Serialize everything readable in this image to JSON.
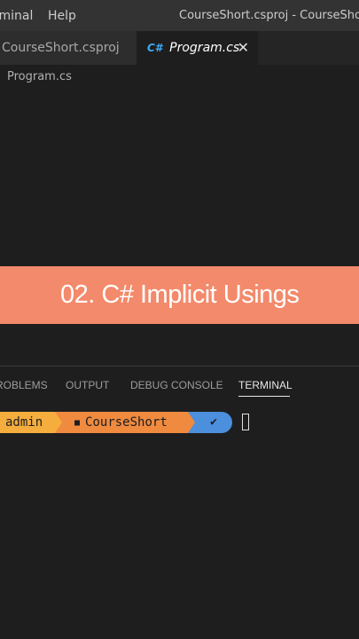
{
  "menu": {
    "terminal": "rminal",
    "help": "Help"
  },
  "window_title": "CourseShort.csproj - CourseShort -",
  "tabs": [
    {
      "label": "CourseShort.csproj",
      "active": false
    },
    {
      "label": "Program.cs",
      "icon": "C#",
      "active": true,
      "close": "✕"
    }
  ],
  "breadcrumb": "Program.cs",
  "banner": {
    "text": "02. C#  Implicit Usings",
    "color": "#f38a6b"
  },
  "panel_tabs": [
    "ROBLEMS",
    "OUTPUT",
    "DEBUG CONSOLE",
    "TERMINAL"
  ],
  "terminal": {
    "user": "admin",
    "path": "CourseShort",
    "folder_icon": "■",
    "status": "✔",
    "colors": {
      "user": "#f5ad3e",
      "path": "#ef8a3f",
      "status": "#4c8fdd"
    }
  }
}
